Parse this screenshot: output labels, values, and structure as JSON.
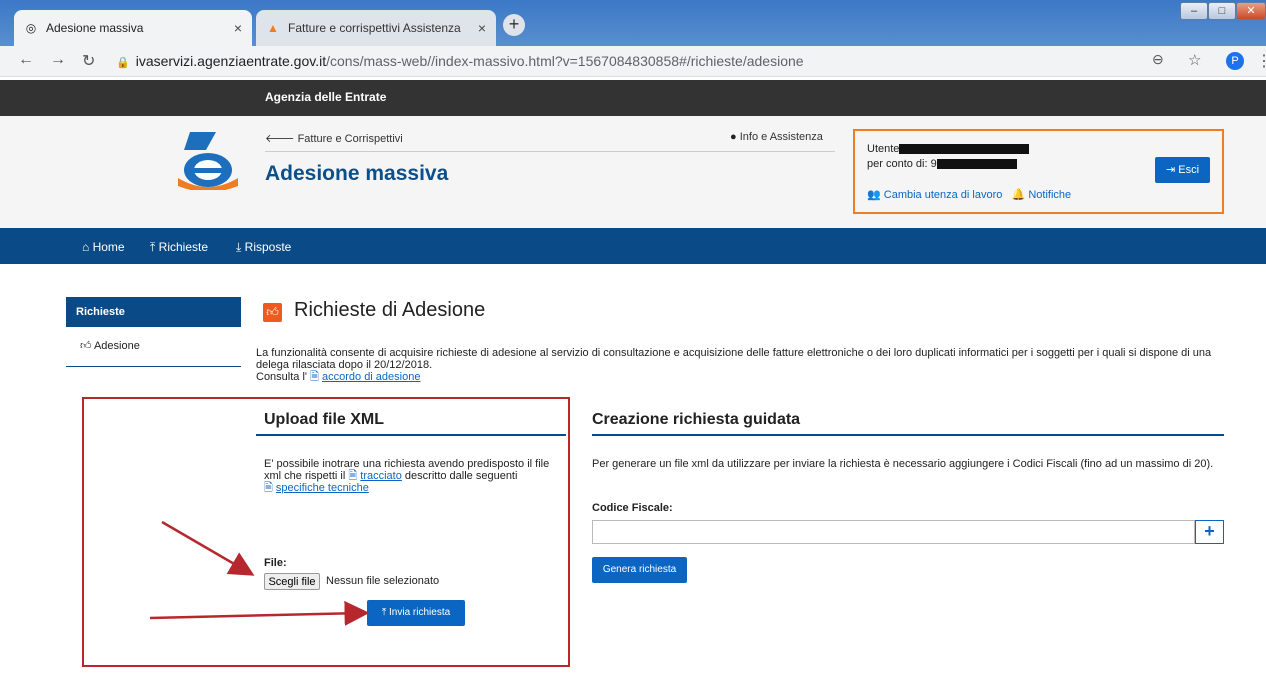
{
  "browser": {
    "tabs": [
      {
        "title": "Adesione massiva"
      },
      {
        "title": "Fatture e corrispettivi Assistenza"
      }
    ],
    "new_tab": "+",
    "url_host": "ivaservizi.agenziaentrate.gov.it",
    "url_path": "/cons/mass-web//index-massivo.html?v=1567084830858#/richieste/adesione",
    "profile_initial": "P"
  },
  "site": {
    "brand": "Agenzia delle Entrate",
    "breadcrumb": "Fatture e Corrispettivi",
    "app_title": "Adesione massiva",
    "info_link": "Info e Assistenza",
    "user": {
      "utente_label": "Utente",
      "per_conto_label": "per conto di: 9",
      "cambia_link": "Cambia utenza di lavoro",
      "notifiche_link": "Notifiche",
      "logout_label": "Esci"
    },
    "nav": [
      "Home",
      "Richieste",
      "Risposte"
    ]
  },
  "sidebar": {
    "header": "Richieste",
    "items": [
      "Adesione"
    ]
  },
  "main": {
    "title": "Richieste di Adesione",
    "description": "La funzionalità consente di acquisire richieste di adesione al servizio di consultazione e acquisizione delle fatture elettroniche o dei loro duplicati informatici per i soggetti per i quali si dispone di una delega rilasciata dopo il 20/12/2018.",
    "consulta_prefix": "Consulta l'",
    "consulta_link": "accordo di adesione",
    "upload": {
      "title": "Upload file XML",
      "text_1": "E' possibile inotrare una richiesta avendo predisposto il file xml che rispetti il",
      "tracciato_link": "tracciato",
      "text_2": "descritto dalle seguenti",
      "specifiche_link": "specifiche tecniche",
      "file_label": "File:",
      "choose_button": "Scegli file",
      "no_file": "Nessun file selezionato",
      "submit_button": "Invia richiesta"
    },
    "guided": {
      "title": "Creazione richiesta guidata",
      "text": "Per generare un file xml da utilizzare per inviare la richiesta è necessario aggiungere i Codici Fiscali (fino ad un massimo di 20).",
      "cf_label": "Codice Fiscale:",
      "add_button": "+",
      "generate_button": "Genera richiesta"
    }
  },
  "colors": {
    "brand_dark": "#0a4a86",
    "button_blue": "#0b66c3",
    "accent_orange": "#ef7d22",
    "annotation_red": "#b7282e"
  }
}
